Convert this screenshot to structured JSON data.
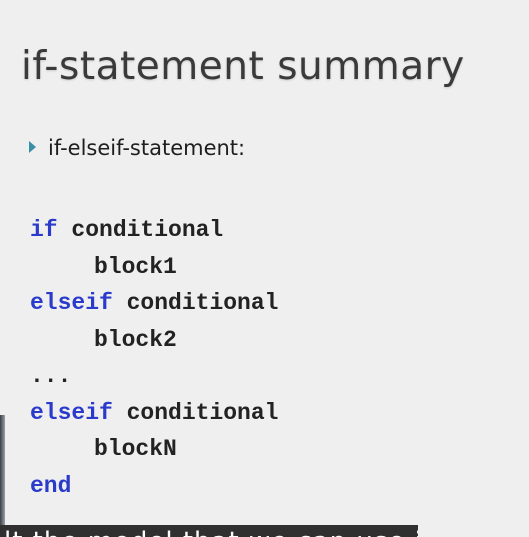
{
  "slide": {
    "title": "if-statement summary",
    "bullet": "if-elseif-statement:",
    "code": [
      {
        "keyword": "if",
        "rest": " conditional"
      },
      {
        "indent": "block1"
      },
      {
        "keyword": "elseif",
        "rest": " conditional"
      },
      {
        "indent": "block2"
      },
      {
        "plain": "..."
      },
      {
        "keyword": "elseif",
        "rest": " conditional"
      },
      {
        "indent": "blockN"
      },
      {
        "keyword": "end"
      }
    ]
  },
  "caption": {
    "text": "lt the model that we can use if"
  },
  "colors": {
    "keyword": "#2a3bcc",
    "background": "#efefef",
    "bullet": "#3a8fa8"
  }
}
